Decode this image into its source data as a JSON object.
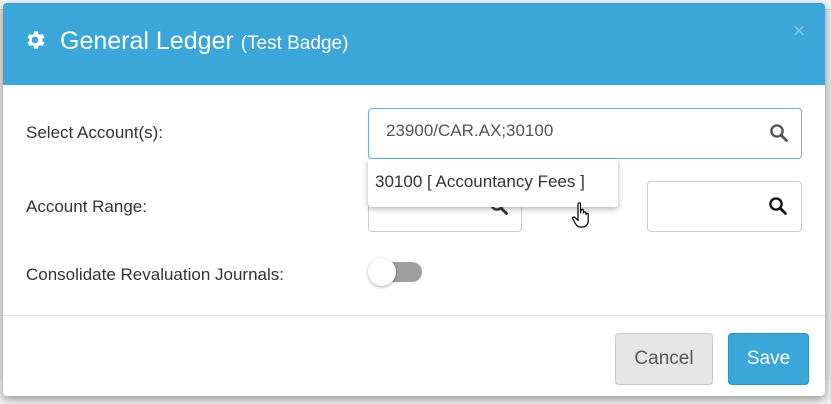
{
  "colors": {
    "header_bg": "#3aa6d9",
    "save_bg": "#3aa6d9",
    "cancel_bg": "#e6e6e6",
    "toggle_off": "#9e9e9e"
  },
  "modal": {
    "icon": "gear-icon",
    "title": "General Ledger",
    "subtitle": "(Test Badge)",
    "close_label": "×"
  },
  "form": {
    "select_accounts": {
      "label": "Select Account(s):",
      "value": "23900/CAR.AX;30100",
      "icon": "search-icon"
    },
    "suggestions": [
      "30100 [ Accountancy Fees ]"
    ],
    "account_range": {
      "label": "Account Range:",
      "from_value": "",
      "to_value": "",
      "icon": "search-icon"
    },
    "consolidate": {
      "label": "Consolidate Revaluation Journals:",
      "enabled": false
    }
  },
  "footer": {
    "cancel_label": "Cancel",
    "save_label": "Save"
  }
}
